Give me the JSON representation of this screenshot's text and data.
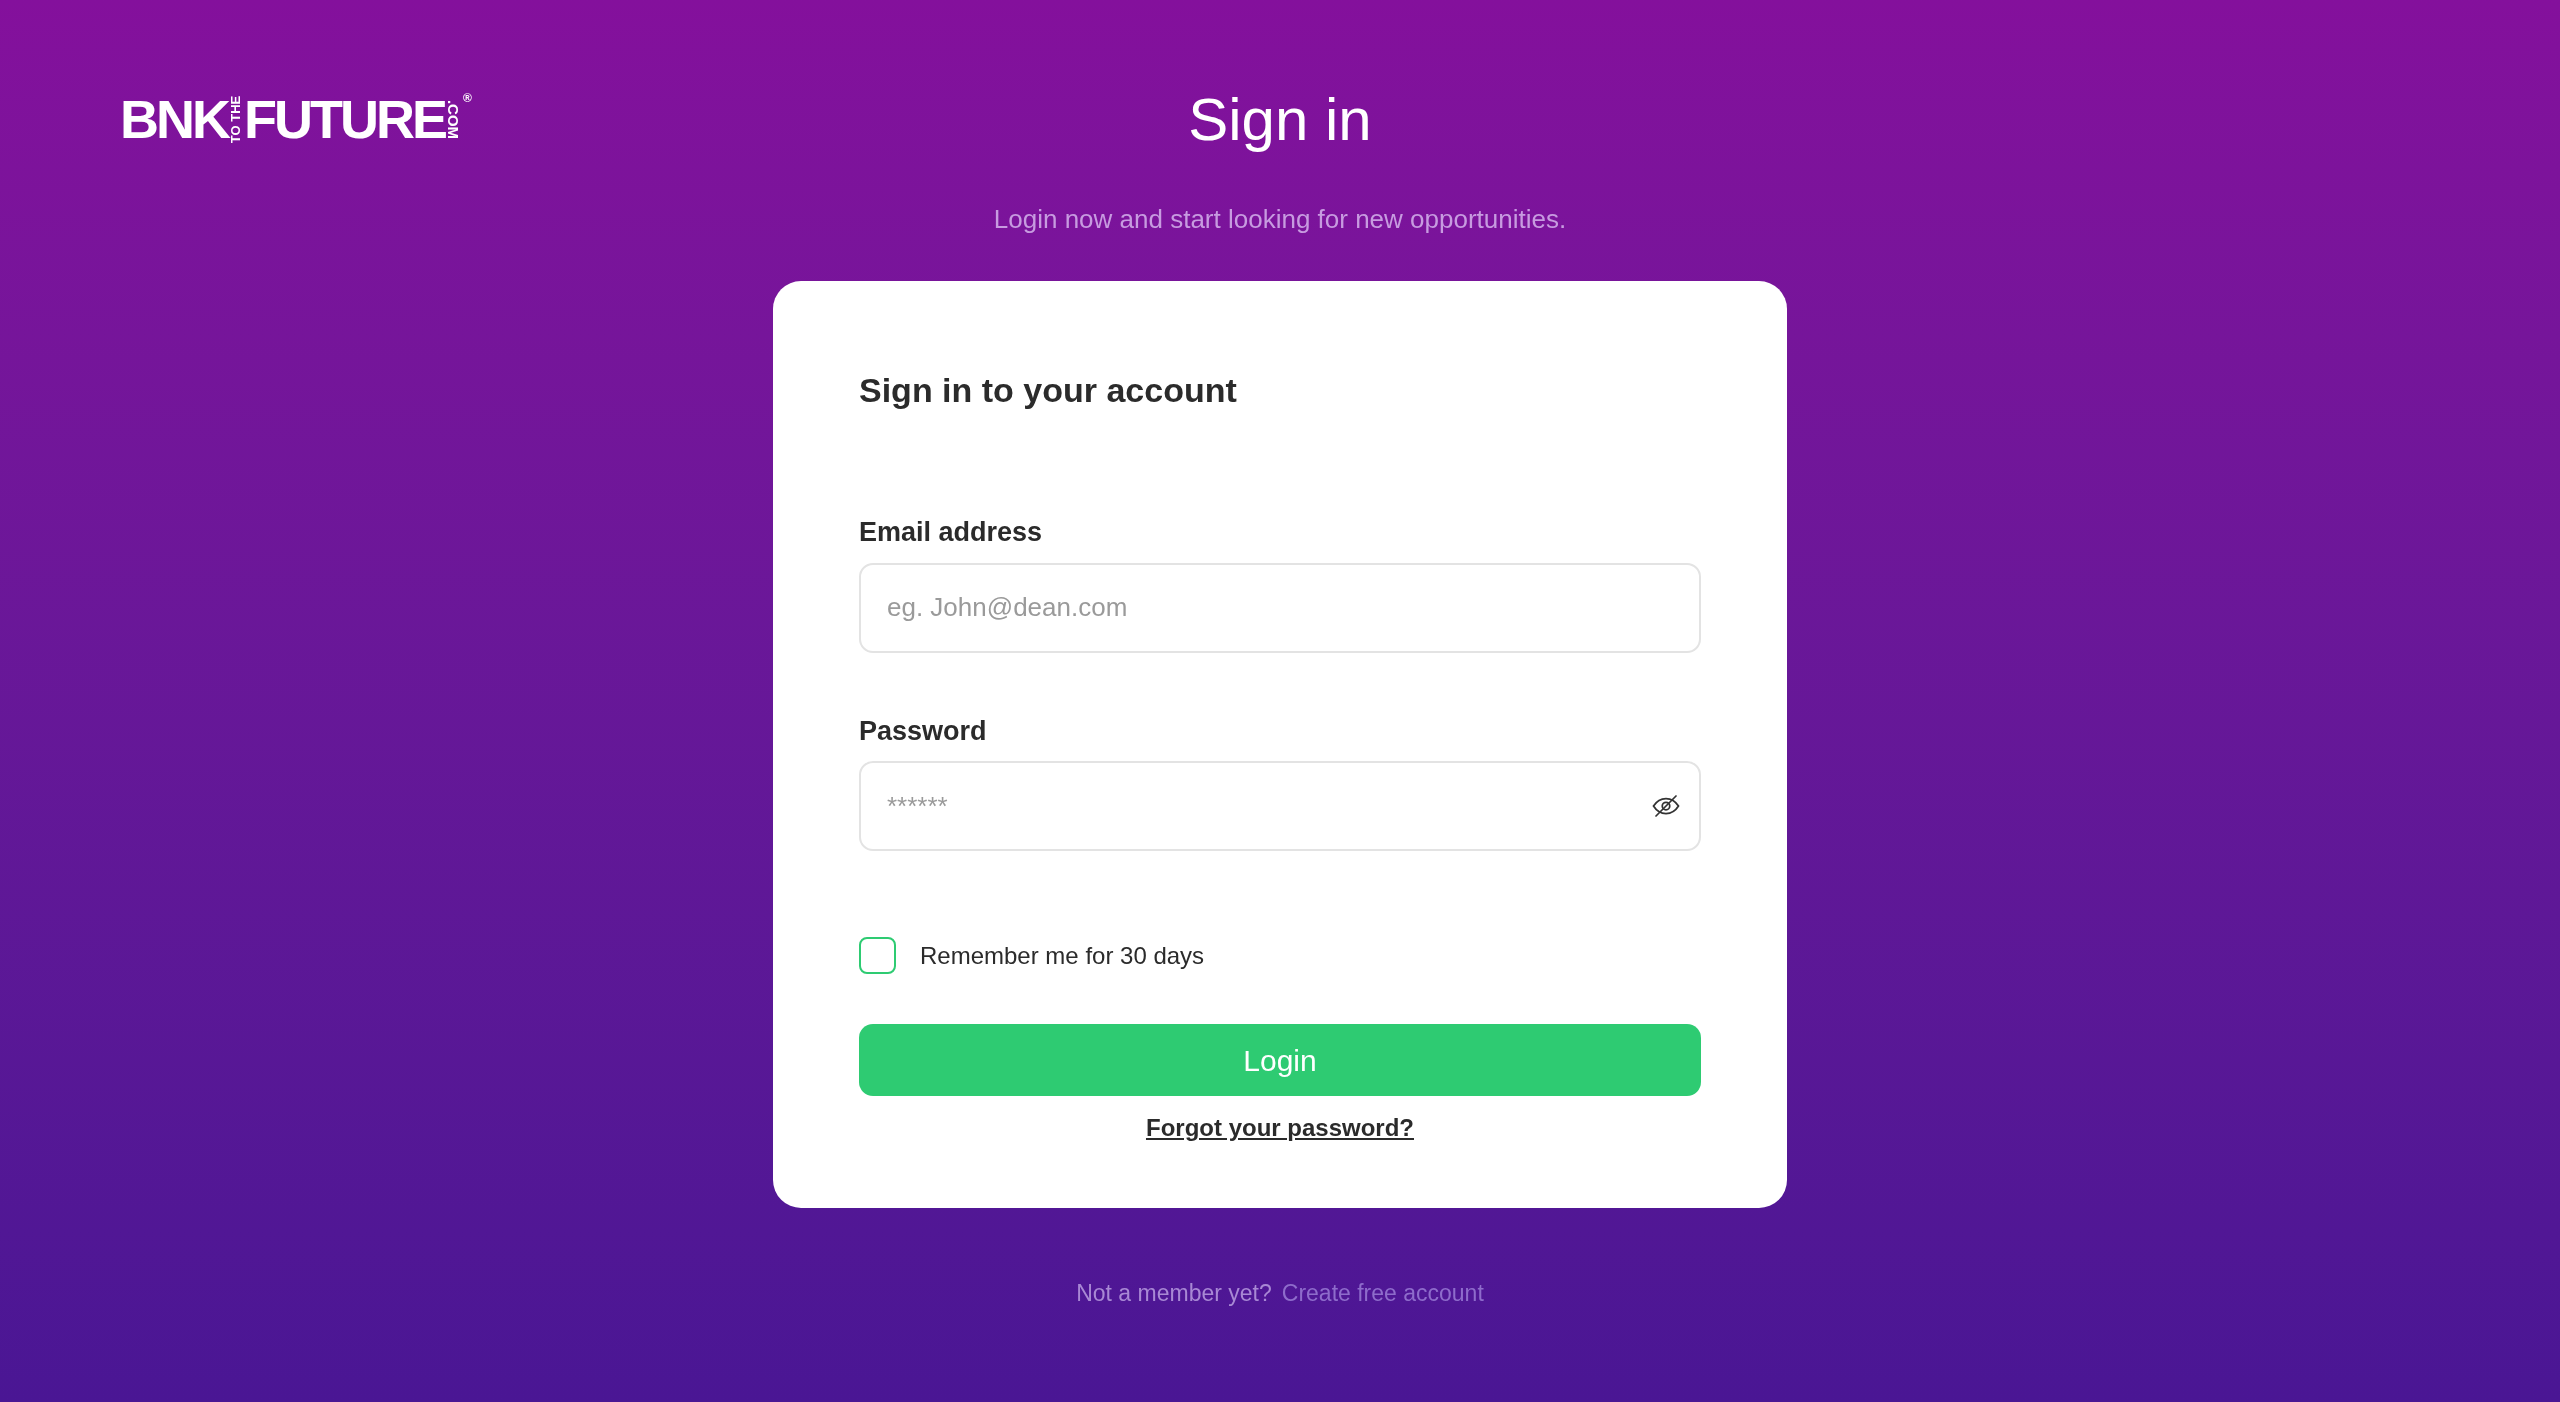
{
  "logo": {
    "part_1": "BNK",
    "part_2": "TO THE",
    "part_3": "FUTURE",
    "part_4": ".COM",
    "mark": "®"
  },
  "header": {
    "title": "Sign in",
    "subtitle": "Login now and start looking for new opportunities."
  },
  "card": {
    "heading": "Sign in to your account",
    "fields": [
      {
        "kind": "text",
        "label": "Email address",
        "placeholder": "eg. John@dean.com"
      },
      {
        "kind": "password",
        "label": "Password",
        "placeholder": "******"
      }
    ],
    "remember": {
      "label": "Remember me for 30 days",
      "checked": false
    },
    "login_button": "Login",
    "forgot_link": "Forgot your password?"
  },
  "footer": {
    "prompt": "Not a member yet?",
    "link": "Create free account"
  }
}
